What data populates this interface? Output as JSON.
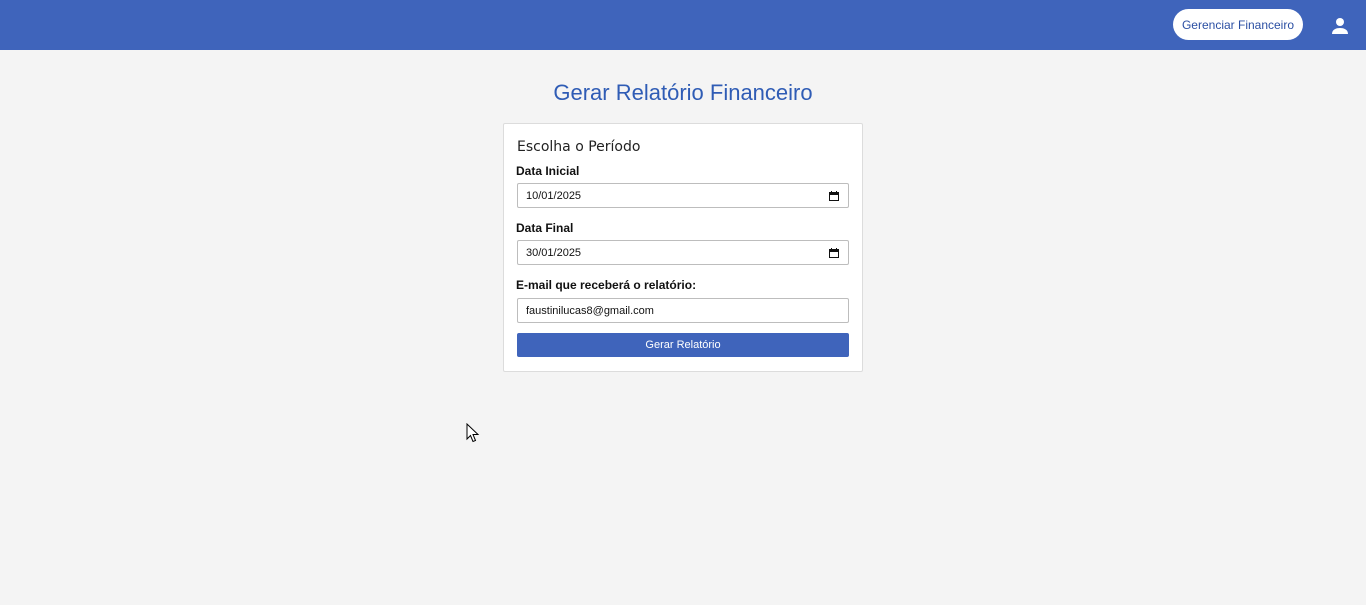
{
  "header": {
    "nav_button_label": "Gerenciar Financeiro",
    "user_icon": "person-icon",
    "accent_color": "#3f64bb"
  },
  "page": {
    "title": "Gerar Relatório Financeiro"
  },
  "form": {
    "section_title": "Escolha o Período",
    "start_date": {
      "label": "Data Inicial",
      "value": "10/01/2025",
      "icon": "calendar-icon"
    },
    "end_date": {
      "label": "Data Final",
      "value": "30/01/2025",
      "icon": "calendar-icon"
    },
    "email": {
      "label": "E-mail que receberá o relatório:",
      "value": "faustinilucas8@gmail.com"
    },
    "submit_label": "Gerar Relatório"
  }
}
